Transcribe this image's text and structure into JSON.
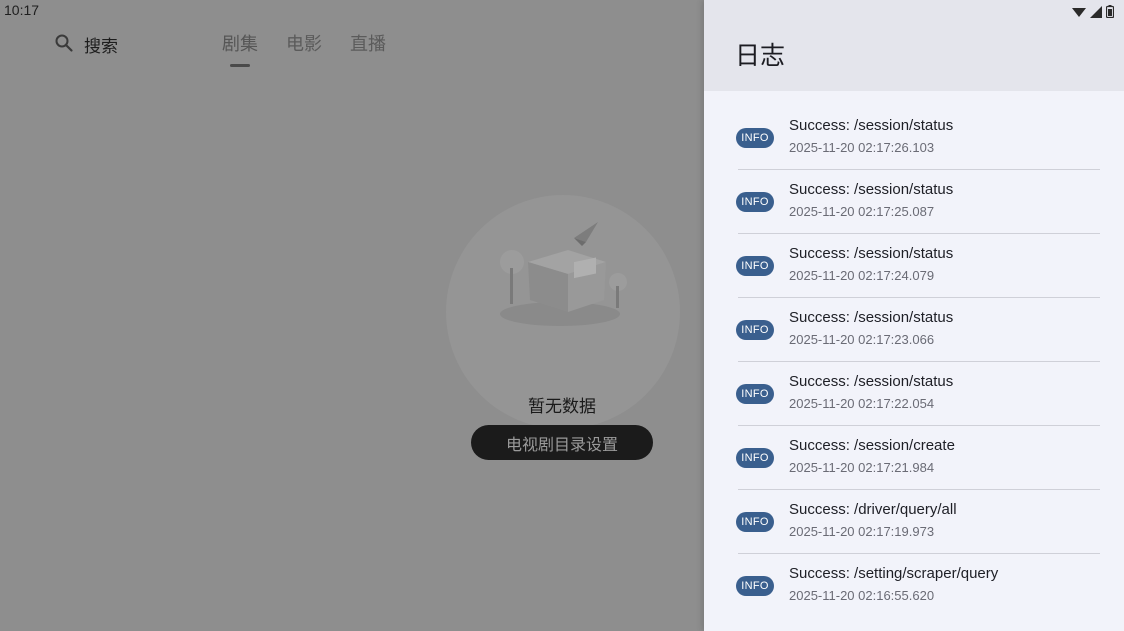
{
  "status_bar": {
    "time": "10:17"
  },
  "header": {
    "search_label": "搜索",
    "tabs": [
      {
        "label": "剧集",
        "active": true
      },
      {
        "label": "电影",
        "active": false
      },
      {
        "label": "直播",
        "active": false
      }
    ]
  },
  "empty_state": {
    "message": "暂无数据",
    "button_label": "电视剧目录设置"
  },
  "log_panel": {
    "title": "日志",
    "entries": [
      {
        "level": "INFO",
        "message": "Success: /session/status",
        "timestamp": "2025-11-20 02:17:26.103"
      },
      {
        "level": "INFO",
        "message": "Success: /session/status",
        "timestamp": "2025-11-20 02:17:25.087"
      },
      {
        "level": "INFO",
        "message": "Success: /session/status",
        "timestamp": "2025-11-20 02:17:24.079"
      },
      {
        "level": "INFO",
        "message": "Success: /session/status",
        "timestamp": "2025-11-20 02:17:23.066"
      },
      {
        "level": "INFO",
        "message": "Success: /session/status",
        "timestamp": "2025-11-20 02:17:22.054"
      },
      {
        "level": "INFO",
        "message": "Success: /session/create",
        "timestamp": "2025-11-20 02:17:21.984"
      },
      {
        "level": "INFO",
        "message": "Success: /driver/query/all",
        "timestamp": "2025-11-20 02:17:19.973"
      },
      {
        "level": "INFO",
        "message": "Success: /setting/scraper/query",
        "timestamp": "2025-11-20 02:16:55.620"
      }
    ]
  },
  "colors": {
    "badge_bg": "#3a5f8e",
    "drawer_bg": "#f2f3fa",
    "drawer_header_bg": "#e4e5ec",
    "scrim": "#8e8e8e"
  },
  "icons": {
    "search": "search-icon",
    "wifi": "wifi-icon",
    "signal": "signal-icon",
    "battery": "battery-icon",
    "empty": "empty-box-illustration"
  }
}
